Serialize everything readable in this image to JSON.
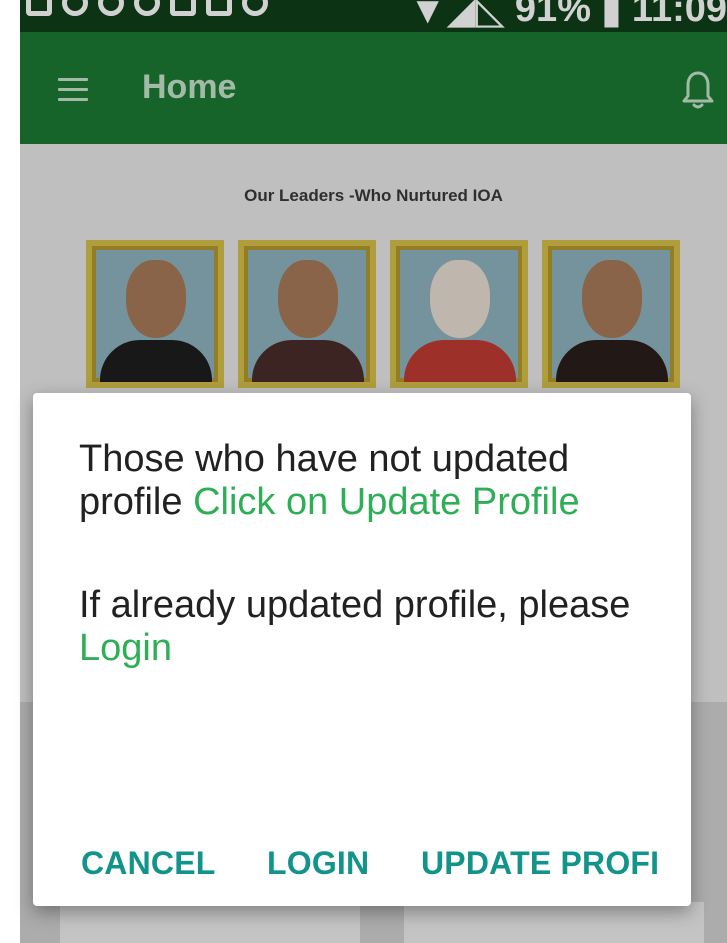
{
  "status_bar": {
    "battery": "91%",
    "time": "11:09"
  },
  "app_bar": {
    "title": "Home",
    "menu_icon": "hamburger-menu-icon",
    "notification_icon": "bell-icon",
    "color": "#1b7a32"
  },
  "content": {
    "leaders_title": "Our Leaders -Who Nurtured IOA"
  },
  "dialog": {
    "line1_text": "Those who have not updated profile ",
    "line1_link": "Click on Update Profile",
    "line2_text": "If already updated profile, please ",
    "line2_link": "Login",
    "buttons": {
      "cancel": "CANCEL",
      "login": "LOGIN",
      "update": "UPDATE PROFI"
    },
    "accent_color": "#12948b",
    "link_color": "#2eae55"
  }
}
